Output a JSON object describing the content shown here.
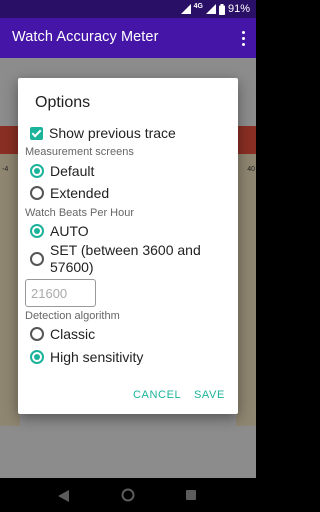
{
  "status_bar": {
    "network": "4G",
    "battery": "91%"
  },
  "app_bar": {
    "title": "Watch Accuracy Meter"
  },
  "background": {
    "left_value": "-4",
    "right_value": "40"
  },
  "dialog": {
    "title": "Options",
    "show_trace": {
      "label": "Show previous trace",
      "checked": true
    },
    "measurement_screens": {
      "label": "Measurement screens",
      "options": [
        {
          "label": "Default",
          "selected": true
        },
        {
          "label": "Extended",
          "selected": false
        }
      ]
    },
    "bph": {
      "label": "Watch Beats Per Hour",
      "options": [
        {
          "label": "AUTO",
          "selected": true
        },
        {
          "label": "SET (between 3600 and 57600)",
          "selected": false
        }
      ],
      "input_placeholder": "21600"
    },
    "detection": {
      "label": "Detection algorithm",
      "options": [
        {
          "label": "Classic",
          "selected": false
        },
        {
          "label": "High sensitivity",
          "selected": true
        }
      ]
    },
    "cancel_label": "CANCEL",
    "save_label": "SAVE"
  },
  "colors": {
    "app_bar": "#4515a8",
    "status_bar": "#2a0f66",
    "accent": "#1bb39a"
  }
}
